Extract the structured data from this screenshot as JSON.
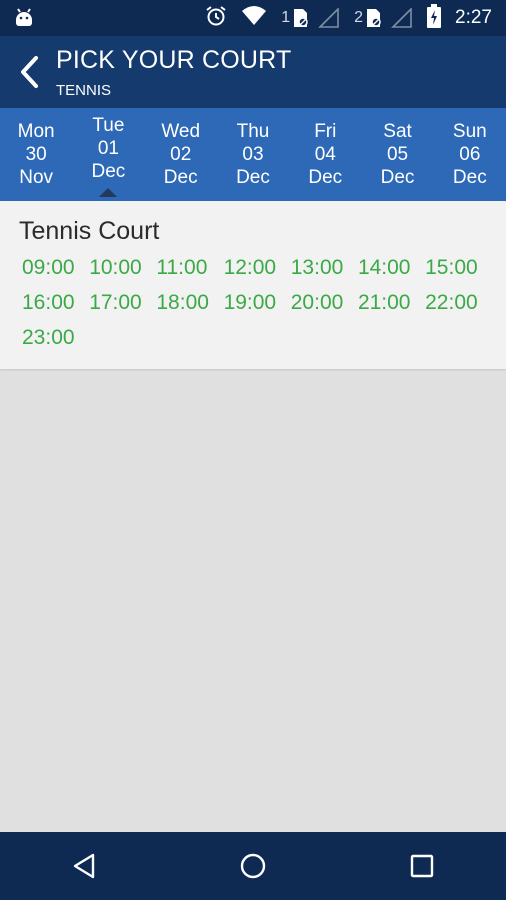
{
  "status_bar": {
    "sim1_label": "1",
    "sim2_label": "2",
    "time": "2:27"
  },
  "header": {
    "title": "PICK YOUR COURT",
    "subtitle": "TENNIS"
  },
  "dates": [
    {
      "weekday": "Mon",
      "day": "30",
      "month": "Nov"
    },
    {
      "weekday": "Tue",
      "day": "01",
      "month": "Dec"
    },
    {
      "weekday": "Wed",
      "day": "02",
      "month": "Dec"
    },
    {
      "weekday": "Thu",
      "day": "03",
      "month": "Dec"
    },
    {
      "weekday": "Fri",
      "day": "04",
      "month": "Dec"
    },
    {
      "weekday": "Sat",
      "day": "05",
      "month": "Dec"
    },
    {
      "weekday": "Sun",
      "day": "06",
      "month": "Dec"
    }
  ],
  "selected_date_index": 1,
  "court": {
    "name": "Tennis Court",
    "slots": [
      "09:00",
      "10:00",
      "11:00",
      "12:00",
      "13:00",
      "14:00",
      "15:00",
      "16:00",
      "17:00",
      "18:00",
      "19:00",
      "20:00",
      "21:00",
      "22:00",
      "23:00"
    ]
  },
  "colors": {
    "status_bar": "#0f2a52",
    "header": "#143a6e",
    "date_strip": "#2d69b7",
    "slot_text": "#3aa946",
    "background": "#e0e0e0"
  },
  "icons": {
    "status_left": "android-debug-icon",
    "alarm": "alarm-icon",
    "wifi": "wifi-icon",
    "battery": "battery-charging-icon",
    "back": "chevron-left-icon",
    "nav_back": "nav-back-triangle-icon",
    "nav_home": "nav-home-circle-icon",
    "nav_recents": "nav-recents-square-icon"
  }
}
